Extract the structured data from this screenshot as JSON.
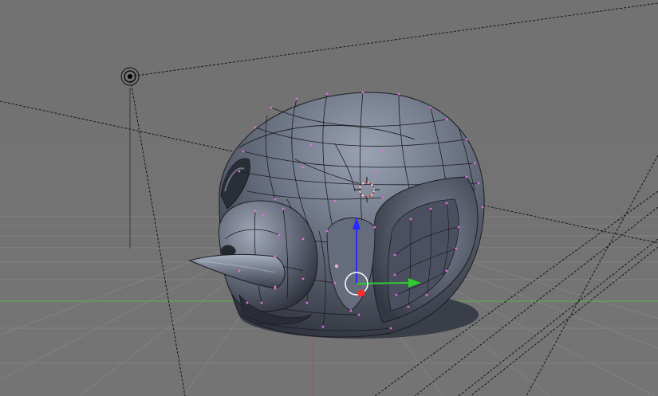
{
  "viewport": {
    "view": "3d-viewport",
    "mode": "edit-mode",
    "background_color": "#737373",
    "grid_color": "#868686",
    "x_axis_color": "#5fa84a",
    "z_axis_color": "#b05050"
  },
  "scene_objects": [
    {
      "name": "lamp",
      "icon": "lamp-icon"
    },
    {
      "name": "camera-frustum-lines",
      "icon": "dashed-lines"
    },
    {
      "name": "mesh-head",
      "description_icon": "mesh-object"
    },
    {
      "name": "3d-cursor",
      "icon": "crosshair-icon"
    }
  ],
  "gizmo": {
    "type": "translate",
    "axes": {
      "x": "#2ecc2e",
      "y": "#ff2a2a",
      "z": "#2a2aff"
    }
  },
  "colors": {
    "mesh_fill": "#5a6070",
    "mesh_highlight": "#8a93a6",
    "mesh_shadow": "#2a2e38",
    "wire": "#1a1c22",
    "vertex": "#e070e0"
  }
}
